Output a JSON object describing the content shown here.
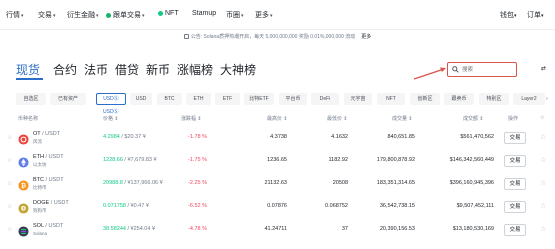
{
  "nav": {
    "items": [
      {
        "label": "行情",
        "caret": true
      },
      {
        "label": "交易",
        "caret": true
      },
      {
        "label": "衍生金融",
        "caret": true
      },
      {
        "label": "跟单交易",
        "caret": true
      },
      {
        "label": "NFT",
        "caret": false
      },
      {
        "label": "Stamup",
        "caret": false
      },
      {
        "label": "币圈",
        "caret": true
      },
      {
        "label": "更多",
        "caret": true
      }
    ],
    "right": [
      {
        "label": "钱包",
        "caret": true
      },
      {
        "label": "订单",
        "caret": true
      }
    ]
  },
  "announcement": {
    "text": "公告: Solana质押热潮开启，每天 5,000,000,000 奖励 0.01%,000,000 流动",
    "more": "更多"
  },
  "market_tabs": [
    "现货",
    "合约",
    "法币",
    "借贷",
    "新币",
    "涨幅榜",
    "大神榜"
  ],
  "active_tab": "现货",
  "search": {
    "placeholder": "搜索"
  },
  "sidebar_toggle": "⇄",
  "filters": [
    "自选区",
    "已有资产",
    "USDⓈ",
    "USD",
    "BTC",
    "ETH",
    "ETF",
    "比特ETF",
    "平台币",
    "DeFi",
    "元宇宙",
    "NFT",
    "创新区",
    "跟卖币",
    "特别区",
    "Layer2"
  ],
  "active_filter": "USDⓈ",
  "sub_filter": "USDⓈ",
  "table": {
    "headers": [
      "币种名称",
      "价格 ⇕",
      "涨跌幅 ⇕",
      "最高价 ⇕",
      "最低价 ⇕",
      "成交量 ⇕",
      "成交额 ⇕",
      "操作",
      "☆"
    ],
    "rows": [
      {
        "symbol": "OT",
        "quote": "/ USDT",
        "name": "风流",
        "price": "4.2984",
        "price_usd": "/ $20.37 ¥",
        "change": "-1.78 %",
        "high": "4.3738",
        "low": "4.1632",
        "volume": "840,651.85",
        "turnover": "$561,470,562",
        "logo_color": "#e8463d",
        "action": "交易"
      },
      {
        "symbol": "ETH",
        "quote": "/ USDT",
        "name": "以太坊",
        "price": "1228.66",
        "price_usd": "/ ¥7,679.83 ¥",
        "change": "-1.75 %",
        "high": "1236.65",
        "low": "1182.92",
        "volume": "179,800,878.92",
        "turnover": "$146,342,560,449",
        "logo_color": "#627eea",
        "action": "交易"
      },
      {
        "symbol": "BTC",
        "quote": "/ USDT",
        "name": "比特币",
        "price": "20988.8",
        "price_usd": "/ ¥137,966.06 ¥",
        "change": "-2.25 %",
        "high": "21132.63",
        "low": "20508",
        "volume": "183,351,314.65",
        "turnover": "$396,160,945,396",
        "logo_color": "#f7931a",
        "action": "交易"
      },
      {
        "symbol": "DOGE",
        "quote": "/ USDT",
        "name": "狗狗币",
        "price": "0.071758",
        "price_usd": "/ ¥0.47 ¥",
        "change": "-6.52 %",
        "high": "0.07876",
        "low": "0.068752",
        "volume": "36,542,738.15",
        "turnover": "$9,507,452,111",
        "logo_color": "#c2a633",
        "action": "交易"
      },
      {
        "symbol": "SOL",
        "quote": "/ USDT",
        "name": "Solana",
        "price": "38.58244",
        "price_usd": "/ ¥254.04 ¥",
        "change": "-4.78 %",
        "high": "41.24711",
        "low": "37",
        "volume": "20,390,156.53",
        "turnover": "$13,180,530,169",
        "logo_color": "#3b3b4f",
        "action": "交易"
      }
    ]
  }
}
